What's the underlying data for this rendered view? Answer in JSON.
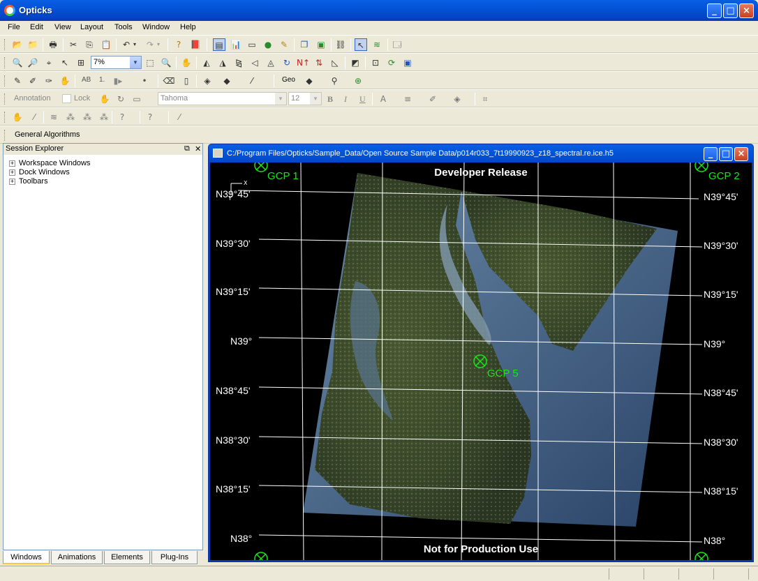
{
  "app": {
    "title": "Opticks"
  },
  "menu": [
    "File",
    "Edit",
    "View",
    "Layout",
    "Tools",
    "Window",
    "Help"
  ],
  "toolbar2": {
    "zoom_value": "7%"
  },
  "toolbar3": {
    "ab_label": "AB",
    "num_label": "1.",
    "geo_label": "Geo"
  },
  "annotation_toolbar": {
    "annotation_label": "Annotation",
    "lock_label": "Lock",
    "font_value": "Tahoma",
    "size_value": "12",
    "bold": "B",
    "italic": "I",
    "underline": "U"
  },
  "algorithms_toolbar": {
    "label": "General Algorithms"
  },
  "session_explorer": {
    "title": "Session Explorer",
    "items": [
      "Workspace Windows",
      "Dock Windows",
      "Toolbars"
    ],
    "tabs": [
      "Windows",
      "Animations",
      "Elements",
      "Plug-Ins"
    ]
  },
  "view_window": {
    "title": "C:/Program Files/Opticks/Sample_Data/Open Source Sample Data/p014r033_7t19990923_z18_spectral.re.ice.h5",
    "top_text": "Developer Release",
    "bottom_text": "Not for Production Use",
    "gcps": [
      "GCP 1",
      "GCP 2",
      "GCP 5"
    ],
    "lat_labels": [
      "N39°45'",
      "N39°30'",
      "N39°15'",
      "N39°",
      "N38°45'",
      "N38°30'",
      "N38°15'",
      "N38°"
    ],
    "axis_x": "X",
    "axis_y": "Y",
    "colors": {
      "gcp": "#19e619",
      "grid": "#ffffff",
      "background": "#000000"
    }
  }
}
